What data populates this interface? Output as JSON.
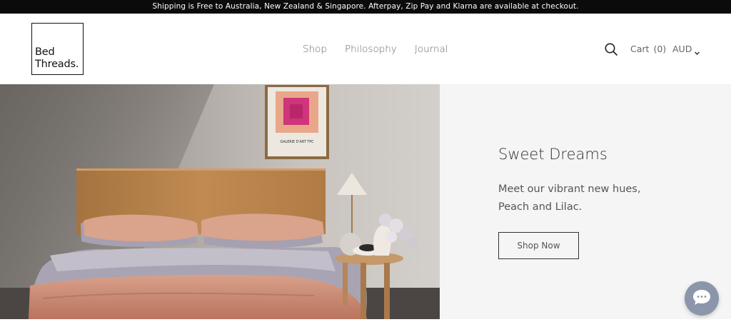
{
  "announcement": {
    "text": "Shipping is Free to Australia, New Zealand & Singapore. Afterpay, Zip Pay and Klarna are available at checkout."
  },
  "logo": {
    "line1": "Bed",
    "line2": "Threads."
  },
  "nav": {
    "items": [
      {
        "label": "Shop"
      },
      {
        "label": "Philosophy"
      },
      {
        "label": "Journal"
      }
    ]
  },
  "header": {
    "search_icon": "search-icon",
    "cart_label": "Cart",
    "cart_count": "(0)",
    "currency": "AUD",
    "currency_icon": "chevron-down-icon"
  },
  "hero": {
    "title": "Sweet Dreams",
    "subtitle_line1": "Meet our vibrant new hues,",
    "subtitle_line2": "Peach and Lilac.",
    "cta_label": "Shop Now",
    "poster_text": "GALERIE D'ART TPC"
  },
  "chat": {
    "icon": "chat-icon"
  },
  "colors": {
    "announcement_bg": "#0b0b0b",
    "panel_bg": "#f5f5f5",
    "chat_bg": "#8c96aa",
    "linen_peach": "#d49c84",
    "linen_lilac": "#a9a4b3"
  }
}
